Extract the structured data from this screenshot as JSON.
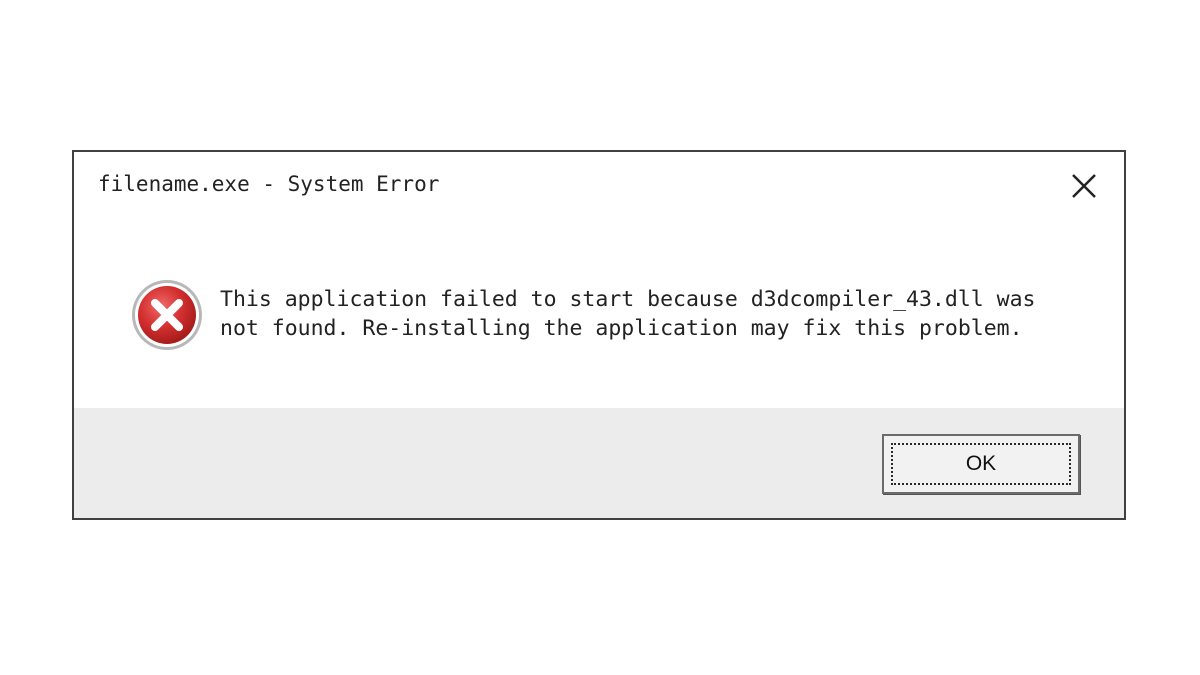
{
  "dialog": {
    "title": "filename.exe - System Error",
    "close_icon": "close-icon",
    "error_icon": "error-x-icon",
    "message_lines": [
      "This application failed to start because d3dcompiler_43.dll was",
      "not found. Re-installing the application may fix this problem."
    ],
    "ok_label": "OK",
    "colors": {
      "border": "#404040",
      "footer": "#ececec",
      "icon_red": "#d43030",
      "text": "#222222"
    }
  }
}
